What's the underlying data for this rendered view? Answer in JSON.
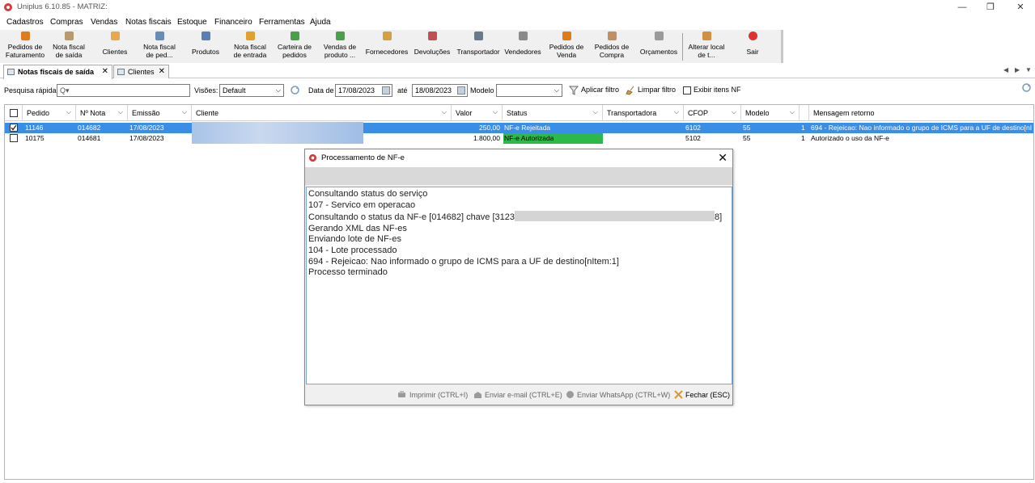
{
  "window": {
    "title": "Uniplus 6.10.85 - MATRIZ:",
    "controls": [
      "—",
      "❐",
      "✕"
    ]
  },
  "menu": [
    "Cadastros",
    "Compras",
    "Vendas",
    "Notas fiscais",
    "Estoque",
    "Financeiro",
    "Ferramentas",
    "Ajuda"
  ],
  "toolbar": [
    {
      "label": "Pedidos de\nFaturamento",
      "icon": "order-icon",
      "color": "#e07b1a"
    },
    {
      "label": "Nota fiscal\nde saída",
      "icon": "invoice-out-icon",
      "color": "#b89b6c"
    },
    {
      "label": "Clientes",
      "icon": "clients-icon",
      "color": "#e8a94a"
    },
    {
      "label": "Nota fiscal\nde ped...",
      "icon": "invoice-order-icon",
      "color": "#6a8bb8"
    },
    {
      "label": "Produtos",
      "icon": "products-icon",
      "color": "#5a7fb5"
    },
    {
      "label": "Nota fiscal\nde entrada",
      "icon": "invoice-in-icon",
      "color": "#e0a030"
    },
    {
      "label": "Carteira de\npedidos",
      "icon": "orders-wallet-icon",
      "color": "#4aa04a"
    },
    {
      "label": "Vendas de\nproduto ...",
      "icon": "sales-icon",
      "color": "#4aa04a"
    },
    {
      "label": "Fornecedores",
      "icon": "suppliers-icon",
      "color": "#d4a040"
    },
    {
      "label": "Devoluções",
      "icon": "returns-icon",
      "color": "#c05050"
    },
    {
      "label": "Transportador",
      "icon": "truck-icon",
      "color": "#6a7a8a"
    },
    {
      "label": "Vendedores",
      "icon": "sellers-icon",
      "color": "#8a8a8a"
    },
    {
      "label": "Pedidos de\nVenda",
      "icon": "sales-order-icon",
      "color": "#e07b1a"
    },
    {
      "label": "Pedidos de\nCompra",
      "icon": "purchase-order-icon",
      "color": "#c09060"
    },
    {
      "label": "Orçamentos",
      "icon": "quotes-icon",
      "color": "#9a9a9a"
    },
    {
      "label": "Alterar local\nde t...",
      "icon": "change-location-icon",
      "color": "#d09040"
    },
    {
      "label": "Sair",
      "icon": "power-icon",
      "color": "#e03030"
    }
  ],
  "tabs": [
    {
      "label": "Notas fiscais de saída",
      "active": true
    },
    {
      "label": "Clientes",
      "active": false
    }
  ],
  "tab_nav": [
    "◀",
    "▶",
    "▼"
  ],
  "filters": {
    "quick_search_label": "Pesquisa rápida:",
    "quick_search_placeholder": "Q▾",
    "views_label": "Visões:",
    "views_value": "Default",
    "date_from_label": "Data de",
    "date_from": "17/08/2023",
    "date_to_label": "até",
    "date_to": "18/08/2023",
    "model_label": "Modelo",
    "model_value": "",
    "apply_label": "Aplicar filtro",
    "clear_label": "Limpar filtro",
    "show_items_label": "Exibir itens NF"
  },
  "grid": {
    "columns": [
      "Pedido",
      "Nº Nota",
      "Emissão",
      "Cliente",
      "Valor",
      "Status",
      "Transportadora",
      "CFOP",
      "Modelo",
      "",
      "Mensagem retorno"
    ],
    "rows": [
      {
        "selected": true,
        "pedido": "11146",
        "nota": "014682",
        "emissao": "17/08/2023",
        "cliente": "",
        "valor": "250,00",
        "status": "NF-e Rejeitada",
        "status_color": "#3a8ee6",
        "transportadora": "",
        "cfop": "6102",
        "modelo": "55",
        "seq": "1",
        "mensagem": "694 - Rejeicao: Nao informado o grupo de ICMS para a UF de destino[nI"
      },
      {
        "selected": false,
        "pedido": "10175",
        "nota": "014681",
        "emissao": "17/08/2023",
        "cliente": "",
        "valor": "1.800,00",
        "status": "NF-e Autorizada",
        "status_color": "#2db84a",
        "transportadora": "",
        "cfop": "5102",
        "modelo": "55",
        "seq": "1",
        "mensagem": "Autorizado o uso da NF-e"
      }
    ]
  },
  "dialog": {
    "title": "Processamento de NF-e",
    "close": "✕",
    "log": [
      "Consultando status do serviço",
      "107 - Servico em operacao",
      "Consultando o status da NF-e [014682] chave [3123",
      "Gerando XML das NF-es",
      "Enviando lote de NF-es",
      "104 - Lote processado",
      "694 - Rejeicao: Nao informado o grupo de ICMS para a UF de destino[nItem:1]",
      "Processo terminado"
    ],
    "log_key_suffix": "8]",
    "buttons": {
      "print": "Imprimir (CTRL+I)",
      "email": "Enviar e-mail (CTRL+E)",
      "whatsapp": "Enviar WhatsApp (CTRL+W)",
      "close": "Fechar (ESC)"
    }
  }
}
